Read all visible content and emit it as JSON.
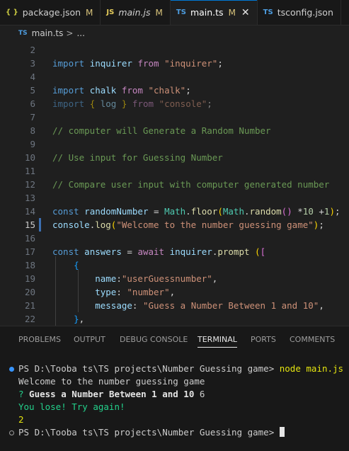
{
  "colors": {
    "accent": "#0078d4",
    "background": "#1f1f1f",
    "panel": "#181818"
  },
  "tabs": [
    {
      "icon": "{ }",
      "label": "package.json",
      "status": "M",
      "active": false,
      "italic": false
    },
    {
      "icon": "JS",
      "label": "main.js",
      "status": "M",
      "active": false,
      "italic": true
    },
    {
      "icon": "TS",
      "label": "main.ts",
      "status": "M",
      "active": true,
      "italic": false,
      "close": "✕"
    },
    {
      "icon": "TS",
      "label": "tsconfig.json",
      "status": "",
      "active": false,
      "italic": false
    }
  ],
  "breadcrumb": {
    "icon": "TS",
    "file": "main.ts",
    "separator": ">",
    "rest": "..."
  },
  "editor": {
    "lines": [
      {
        "n": "2",
        "tokens": []
      },
      {
        "n": "3",
        "tokens": [
          [
            "kw",
            "import"
          ],
          [
            "pl",
            " "
          ],
          [
            "var",
            "inquirer"
          ],
          [
            "pl",
            " "
          ],
          [
            "kwp",
            "from"
          ],
          [
            "pl",
            " "
          ],
          [
            "str",
            "\"inquirer\""
          ],
          [
            "pl",
            ";"
          ]
        ]
      },
      {
        "n": "4",
        "tokens": []
      },
      {
        "n": "5",
        "tokens": [
          [
            "kw",
            "import"
          ],
          [
            "pl",
            " "
          ],
          [
            "var",
            "chalk"
          ],
          [
            "pl",
            " "
          ],
          [
            "kwp",
            "from"
          ],
          [
            "pl",
            " "
          ],
          [
            "str",
            "\"chalk\""
          ],
          [
            "pl",
            ";"
          ]
        ]
      },
      {
        "n": "6",
        "dim": true,
        "tokens": [
          [
            "kw",
            "import"
          ],
          [
            "pl",
            " "
          ],
          [
            "b1",
            "{"
          ],
          [
            "pl",
            " "
          ],
          [
            "var",
            "log"
          ],
          [
            "pl",
            " "
          ],
          [
            "b1",
            "}"
          ],
          [
            "pl",
            " "
          ],
          [
            "kwp",
            "from"
          ],
          [
            "pl",
            " "
          ],
          [
            "str",
            "\"console\""
          ],
          [
            "pl",
            ";"
          ]
        ]
      },
      {
        "n": "7",
        "tokens": []
      },
      {
        "n": "8",
        "tokens": [
          [
            "cm",
            "// computer will Generate a Random Number"
          ]
        ]
      },
      {
        "n": "9",
        "tokens": []
      },
      {
        "n": "10",
        "tokens": [
          [
            "cm",
            "// Use input for Guessing Number"
          ]
        ]
      },
      {
        "n": "11",
        "tokens": []
      },
      {
        "n": "12",
        "tokens": [
          [
            "cm",
            "// Compare user input with computer generated number"
          ]
        ]
      },
      {
        "n": "13",
        "tokens": []
      },
      {
        "n": "14",
        "tokens": [
          [
            "kw",
            "const"
          ],
          [
            "pl",
            " "
          ],
          [
            "var",
            "randomNumber"
          ],
          [
            "pl",
            " = "
          ],
          [
            "cls",
            "Math"
          ],
          [
            "pl",
            "."
          ],
          [
            "fn",
            "floor"
          ],
          [
            "b1",
            "("
          ],
          [
            "cls",
            "Math"
          ],
          [
            "pl",
            "."
          ],
          [
            "fn",
            "random"
          ],
          [
            "b2",
            "()"
          ],
          [
            "pl",
            " *"
          ],
          [
            "num",
            "10"
          ],
          [
            "pl",
            " +"
          ],
          [
            "num",
            "1"
          ],
          [
            "b1",
            ")"
          ],
          [
            "pl",
            ";"
          ]
        ]
      },
      {
        "n": "15",
        "current": true,
        "tokens": [
          [
            "var",
            "console"
          ],
          [
            "pl",
            "."
          ],
          [
            "fn",
            "log"
          ],
          [
            "b1",
            "("
          ],
          [
            "str",
            "\"Welcome to the number guessing game\""
          ],
          [
            "b1",
            ")"
          ],
          [
            "pl",
            ";"
          ]
        ]
      },
      {
        "n": "16",
        "tokens": []
      },
      {
        "n": "17",
        "tokens": [
          [
            "kw",
            "const"
          ],
          [
            "pl",
            " "
          ],
          [
            "var",
            "answers"
          ],
          [
            "pl",
            " = "
          ],
          [
            "kwp",
            "await"
          ],
          [
            "pl",
            " "
          ],
          [
            "var",
            "inquirer"
          ],
          [
            "pl",
            "."
          ],
          [
            "fn",
            "prompt"
          ],
          [
            "pl",
            " "
          ],
          [
            "b1",
            "("
          ],
          [
            "b2",
            "["
          ]
        ]
      },
      {
        "n": "18",
        "tokens": [
          [
            "pl",
            "    "
          ],
          [
            "b3",
            "{"
          ]
        ]
      },
      {
        "n": "19",
        "tokens": [
          [
            "pl",
            "        "
          ],
          [
            "var",
            "name"
          ],
          [
            "pl",
            ":"
          ],
          [
            "str",
            "\"userGuessnumber\""
          ],
          [
            "pl",
            ","
          ]
        ]
      },
      {
        "n": "20",
        "tokens": [
          [
            "pl",
            "        "
          ],
          [
            "var",
            "type"
          ],
          [
            "pl",
            ": "
          ],
          [
            "str",
            "\"number\""
          ],
          [
            "pl",
            ","
          ]
        ]
      },
      {
        "n": "21",
        "tokens": [
          [
            "pl",
            "        "
          ],
          [
            "var",
            "message"
          ],
          [
            "pl",
            ": "
          ],
          [
            "str",
            "\"Guess a Number Between 1 and 10\""
          ],
          [
            "pl",
            ","
          ]
        ]
      },
      {
        "n": "22",
        "tokens": [
          [
            "pl",
            "    "
          ],
          [
            "b3",
            "}"
          ],
          [
            "pl",
            ","
          ]
        ]
      }
    ]
  },
  "panel": {
    "tabs": [
      {
        "label": "PROBLEMS",
        "active": false
      },
      {
        "label": "OUTPUT",
        "active": false
      },
      {
        "label": "DEBUG CONSOLE",
        "active": false
      },
      {
        "label": "TERMINAL",
        "active": true
      },
      {
        "label": "PORTS",
        "active": false
      },
      {
        "label": "COMMENTS",
        "active": false
      }
    ]
  },
  "terminal": {
    "prompt1": "PS D:\\Tooba ts\\TS projects\\Number Guessing game>",
    "command": " node main.js",
    "welcome": "Welcome to the number guessing game",
    "question_mark": "?",
    "question": " Guess a Number Between 1 and 10",
    "answer": " 6",
    "result": "You lose! Try again!",
    "number": "2",
    "prompt2": "PS D:\\Tooba ts\\TS projects\\Number Guessing game>"
  }
}
